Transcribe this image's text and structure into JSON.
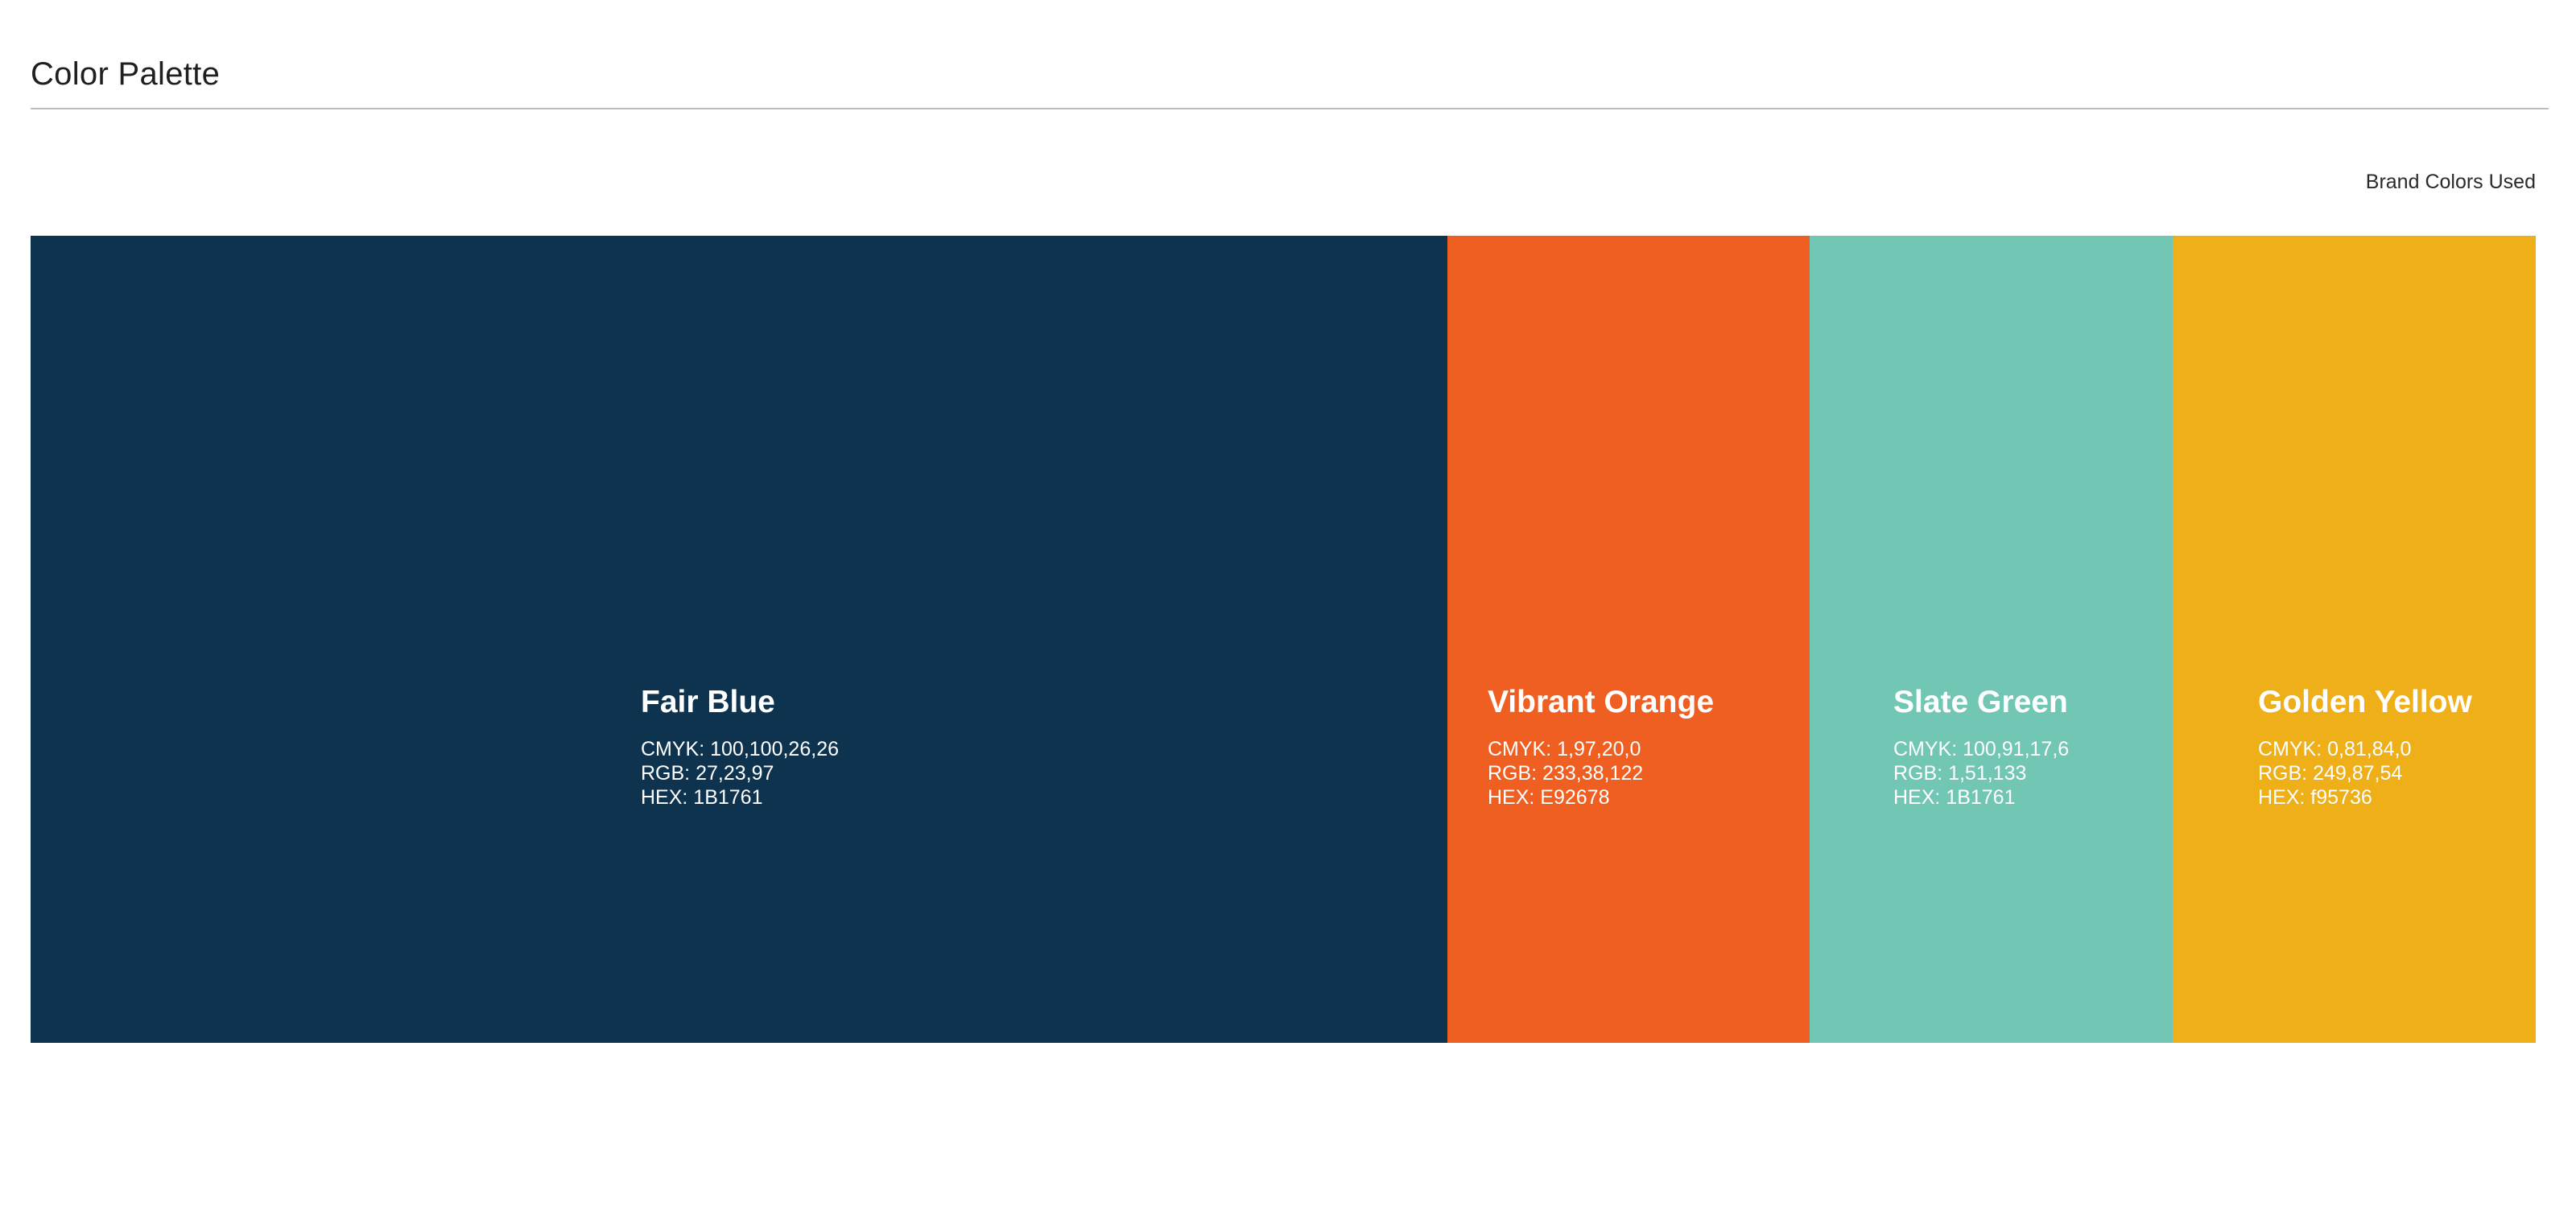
{
  "page": {
    "title": "Color Palette",
    "subtitle": "Brand Colors Used"
  },
  "swatches": [
    {
      "name": "Fair Blue",
      "cmyk": "CMYK: 100,100,26,26",
      "rgb": "RGB: 27,23,97",
      "hex": "HEX: 1B1761",
      "color": "#0d334f"
    },
    {
      "name": "Vibrant Orange",
      "cmyk": "CMYK: 1,97,20,0",
      "rgb": "RGB: 233,38,122",
      "hex": "HEX: E92678",
      "color": "#f05f22"
    },
    {
      "name": "Slate Green",
      "cmyk": "CMYK: 100,91,17,6",
      "rgb": "RGB: 1,51,133",
      "hex": "HEX: 1B1761",
      "color": "#72c6b4"
    },
    {
      "name": "Golden Yellow",
      "cmyk": "CMYK: 0,81,84,0",
      "rgb": "RGB: 249,87,54",
      "hex": "HEX: f95736",
      "color": "#eeaf18"
    }
  ]
}
